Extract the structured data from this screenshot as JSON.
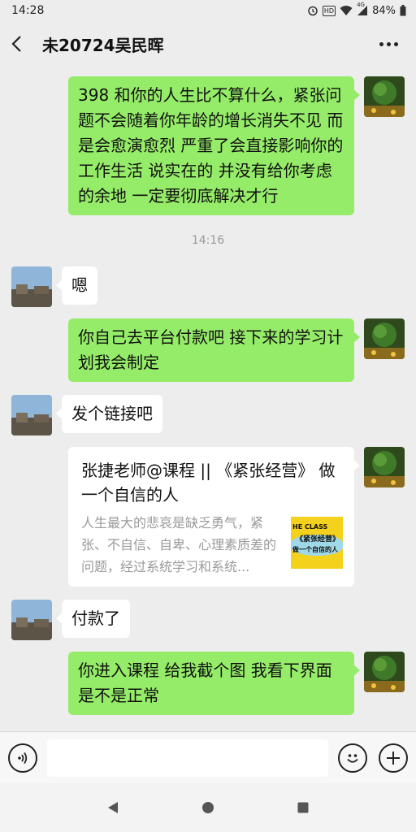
{
  "status_bar": {
    "time": "14:28",
    "network": "4G",
    "hd": "HD",
    "battery": "84%"
  },
  "chat": {
    "title": "未20724吴民晖"
  },
  "messages": [
    {
      "sender": "me",
      "type": "text",
      "text": "398 和你的人生比不算什么，紧张问题不会随着你年龄的增长消失不见 而是会愈演愈烈 严重了会直接影响你的工作生活  说实在的 并没有给你考虑的余地 一定要彻底解决才行"
    },
    {
      "type": "time",
      "text": "14:16"
    },
    {
      "sender": "other",
      "type": "text",
      "text": "嗯"
    },
    {
      "sender": "me",
      "type": "text",
      "text": "你自己去平台付款吧  接下来的学习计划我会制定"
    },
    {
      "sender": "other",
      "type": "text",
      "text": "发个链接吧"
    },
    {
      "sender": "me",
      "type": "link",
      "title": "张捷老师@课程 || 《紧张经营》 做一个自信的人",
      "desc": "人生最大的悲哀是缺乏勇气，紧张、不自信、自卑、心理素质差的问题，经过系统学习和系统...",
      "thumb_lines": [
        "HE CLASS",
        "《紧张经营》",
        "做一个自信的人"
      ]
    },
    {
      "sender": "other",
      "type": "text",
      "text": "付款了"
    },
    {
      "sender": "me",
      "type": "text",
      "text": "你进入课程 给我截个图  我看下界面是不是正常"
    }
  ],
  "colors": {
    "my_bubble": "#95ec69",
    "other_bubble": "#ffffff",
    "background": "#ededed"
  },
  "icons": {
    "back": "chevron-left-icon",
    "more": "more-dots-icon",
    "voice": "voice-icon",
    "emoji": "emoji-icon",
    "add": "plus-icon",
    "nav_back": "triangle-back-icon",
    "nav_home": "circle-home-icon",
    "nav_recent": "square-recent-icon"
  }
}
